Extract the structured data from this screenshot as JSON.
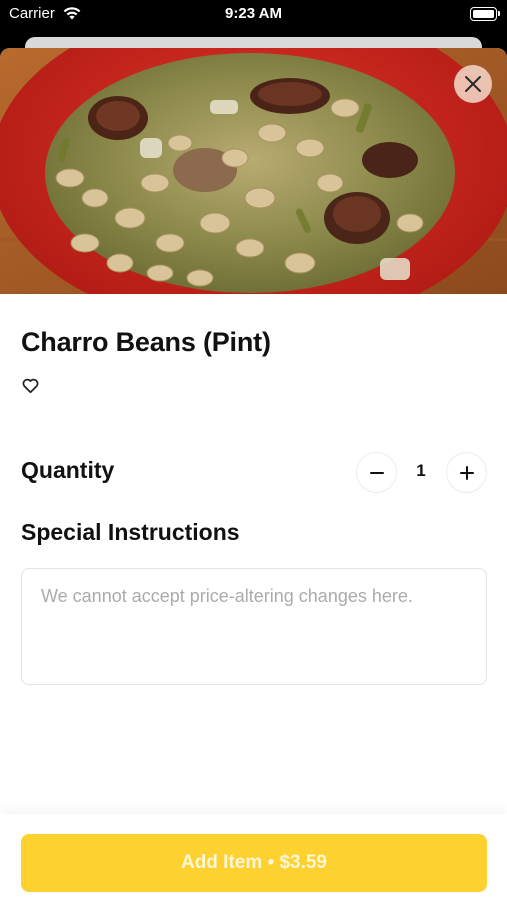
{
  "status_bar": {
    "carrier": "Carrier",
    "time": "9:23 AM",
    "wifi_icon": "wifi-icon",
    "battery_icon": "battery-icon"
  },
  "item": {
    "title": "Charro Beans (Pint)",
    "image_description": "bowl-of-charro-beans",
    "favorite_icon": "heart-outline-icon"
  },
  "close_icon": "close-icon",
  "quantity": {
    "label": "Quantity",
    "value": "1",
    "decrement_icon": "minus-icon",
    "increment_icon": "plus-icon"
  },
  "special_instructions": {
    "label": "Special Instructions",
    "placeholder": "We cannot accept price-altering changes here.",
    "value": ""
  },
  "footer": {
    "add_button_label": "Add Item • $3.59"
  },
  "colors": {
    "accent": "#fdd12f",
    "close_button_bg": "#f0cdbe",
    "text": "#111111",
    "placeholder": "#ababab"
  }
}
